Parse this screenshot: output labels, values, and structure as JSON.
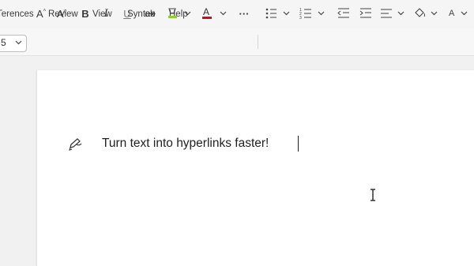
{
  "menubar": {
    "items": [
      {
        "label": "Terences"
      },
      {
        "label": "Review"
      },
      {
        "label": "View"
      },
      {
        "label": "Syntex"
      },
      {
        "label": "Help"
      }
    ]
  },
  "toolbar": {
    "font_size": "5",
    "grow_font_label": "A",
    "shrink_font_label": "A",
    "bold_label": "B",
    "italic_label": "I",
    "underline_label": "U",
    "strike_label": "ab",
    "more_label": "···",
    "font_color": "#c50f1f",
    "highlight_color": "#8fcf2a"
  },
  "document": {
    "text": "Turn text into hyperlinks faster!"
  }
}
